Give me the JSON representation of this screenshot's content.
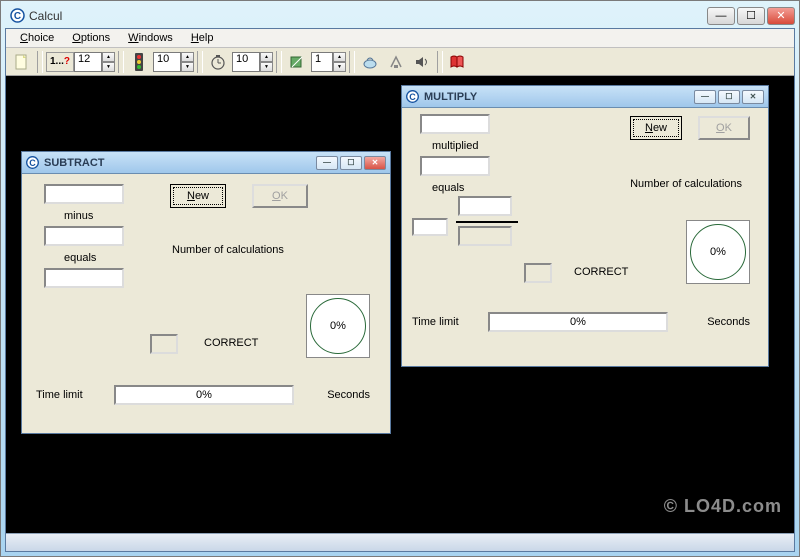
{
  "app": {
    "title": "Calcul",
    "watermark": "© LO4D.com"
  },
  "menu": {
    "choice": "Choice",
    "options": "Options",
    "windows": "Windows",
    "help": "Help"
  },
  "toolbar": {
    "questionPrefix": "1...?",
    "questionValue": "12",
    "countValue": "10",
    "timerValue": "10",
    "selValue": "1"
  },
  "windows": {
    "subtract": {
      "title": "SUBTRACT",
      "minus": "minus",
      "equals": "equals",
      "new": "New",
      "ok": "OK",
      "numCalc": "Number of calculations",
      "correct": "CORRECT",
      "gauge": "0%",
      "timeLimit": "Time limit",
      "progress": "0%",
      "seconds": "Seconds"
    },
    "multiply": {
      "title": "MULTIPLY",
      "multiplied": "multiplied",
      "equals": "equals",
      "new": "New",
      "ok": "OK",
      "numCalc": "Number of calculations",
      "correct": "CORRECT",
      "gauge": "0%",
      "timeLimit": "Time limit",
      "progress": "0%",
      "seconds": "Seconds"
    }
  }
}
